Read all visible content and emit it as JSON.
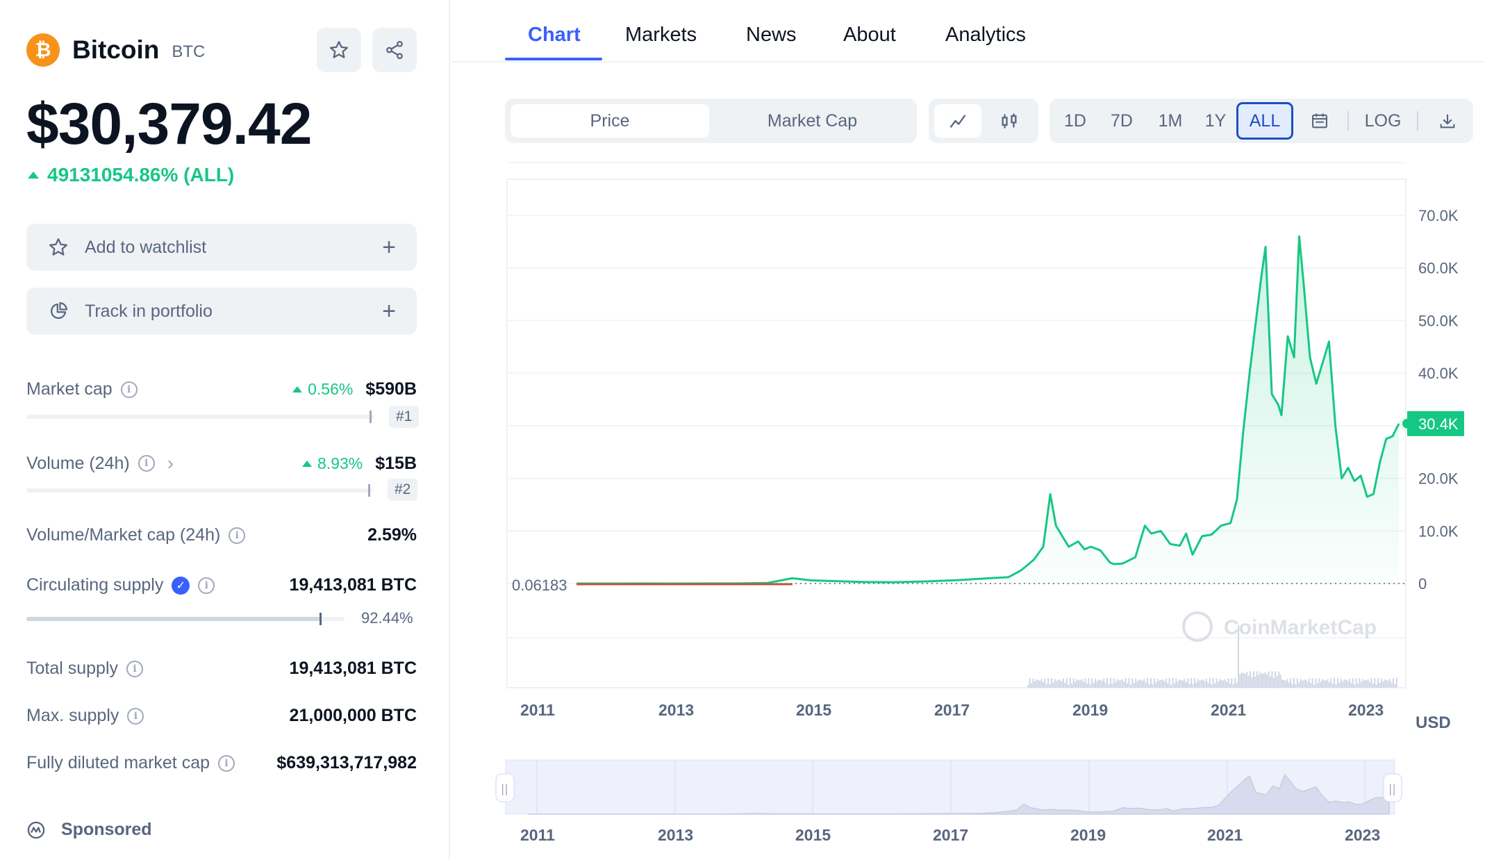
{
  "coin": {
    "name": "Bitcoin",
    "symbol": "BTC",
    "logo_glyph": "₿",
    "price": "$30,379.42",
    "change": "49131054.86% (ALL)"
  },
  "actions": {
    "watchlist": "Add to watchlist",
    "portfolio": "Track in portfolio",
    "plus": "+"
  },
  "stats": {
    "market_cap": {
      "label": "Market cap",
      "change": "0.56%",
      "value": "$590B",
      "rank": "#1"
    },
    "volume": {
      "label": "Volume (24h)",
      "change": "8.93%",
      "value": "$15B",
      "rank": "#2"
    },
    "vol_mcap": {
      "label": "Volume/Market cap (24h)",
      "value": "2.59%"
    },
    "circulating": {
      "label": "Circulating supply",
      "value": "19,413,081 BTC",
      "percent": "92.44%",
      "fraction": 0.9244
    },
    "total": {
      "label": "Total supply",
      "value": "19,413,081 BTC"
    },
    "max": {
      "label": "Max. supply",
      "value": "21,000,000 BTC"
    },
    "fdmc": {
      "label": "Fully diluted market cap",
      "value": "$639,313,717,982"
    }
  },
  "sponsored": "Sponsored",
  "tabs": [
    "Chart",
    "Markets",
    "News",
    "About",
    "Analytics"
  ],
  "toolbar": {
    "price": "Price",
    "market_cap": "Market Cap",
    "ranges": [
      "1D",
      "7D",
      "1M",
      "1Y",
      "ALL"
    ],
    "active_range": "ALL",
    "log": "LOG"
  },
  "colors": {
    "accent": "#3861fb",
    "positive": "#16c784",
    "muted": "#58667e",
    "btc": "#f7931a"
  },
  "chart_data": {
    "type": "line",
    "series": [
      {
        "x": [
          2010.5,
          2011.0,
          2011.5,
          2012.0,
          2012.5,
          2013.0,
          2013.5,
          2013.9,
          2014.2,
          2014.6,
          2015.0,
          2015.5,
          2016.0,
          2016.5,
          2017.0,
          2017.3,
          2017.5,
          2017.7,
          2017.85,
          2017.96,
          2018.05,
          2018.15,
          2018.25,
          2018.4,
          2018.5,
          2018.6,
          2018.75,
          2018.9,
          2018.96,
          2019.1,
          2019.3,
          2019.45,
          2019.55,
          2019.7,
          2019.85,
          2020.0,
          2020.1,
          2020.2,
          2020.35,
          2020.5,
          2020.65,
          2020.8,
          2020.9,
          2021.0,
          2021.1,
          2021.2,
          2021.28,
          2021.35,
          2021.45,
          2021.55,
          2021.6,
          2021.7,
          2021.8,
          2021.88,
          2021.95,
          2022.05,
          2022.15,
          2022.25,
          2022.35,
          2022.45,
          2022.55,
          2022.65,
          2022.75,
          2022.85,
          2022.95,
          2023.05,
          2023.15,
          2023.25,
          2023.35,
          2023.45
        ],
        "values": [
          0.06183,
          1,
          15,
          5,
          7,
          13,
          90,
          1000,
          600,
          450,
          300,
          250,
          400,
          650,
          1000,
          1200,
          2500,
          4500,
          7000,
          17000,
          11000,
          9000,
          7000,
          8000,
          6500,
          7000,
          6300,
          4000,
          3700,
          3800,
          5000,
          11000,
          9500,
          10000,
          7500,
          7200,
          9500,
          5500,
          9000,
          9300,
          11000,
          11500,
          16000,
          29000,
          40000,
          50000,
          58000,
          64000,
          36000,
          34000,
          32000,
          47000,
          43000,
          66000,
          57000,
          43000,
          38000,
          42000,
          46000,
          30000,
          20000,
          22000,
          19500,
          20500,
          16500,
          17000,
          23000,
          27500,
          28000,
          30400
        ],
        "current": "30.4K",
        "start_label": "0.06183"
      }
    ],
    "y_ticks": [
      "0",
      "10.0K",
      "20.0K",
      "30.0K",
      "40.0K",
      "50.0K",
      "60.0K",
      "70.0K"
    ],
    "y_tick_labels": [
      "0",
      "10.0K",
      "20.0K",
      "40.0K",
      "50.0K",
      "60.0K",
      "70.0K"
    ],
    "y_tick_values": [
      0,
      10000,
      20000,
      40000,
      50000,
      60000,
      70000
    ],
    "ylim": [
      0,
      70000
    ],
    "x_ticks": [
      "2011",
      "2013",
      "2015",
      "2017",
      "2019",
      "2021",
      "2023"
    ],
    "currency": "USD",
    "watermark": "CoinMarketCap"
  }
}
